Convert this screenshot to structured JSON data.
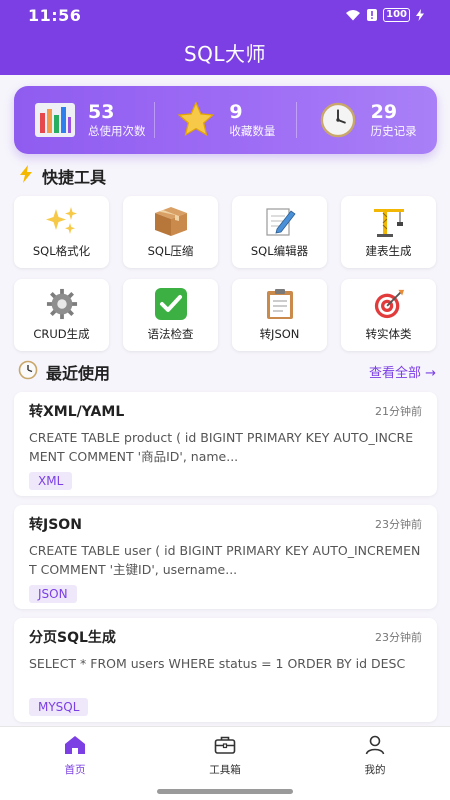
{
  "status": {
    "time": "11:56",
    "battery": "100"
  },
  "app": {
    "title": "SQL大师"
  },
  "stats": [
    {
      "value": "53",
      "label": "总使用次数",
      "icon": "bar-chart-icon"
    },
    {
      "value": "9",
      "label": "收藏数量",
      "icon": "star-icon"
    },
    {
      "value": "29",
      "label": "历史记录",
      "icon": "clock-icon"
    }
  ],
  "quick_tools": {
    "heading": "快捷工具",
    "items": [
      {
        "label": "SQL格式化",
        "icon": "sparkles-icon"
      },
      {
        "label": "SQL压缩",
        "icon": "package-icon"
      },
      {
        "label": "SQL编辑器",
        "icon": "notepad-pencil-icon"
      },
      {
        "label": "建表生成",
        "icon": "crane-icon"
      },
      {
        "label": "CRUD生成",
        "icon": "gear-icon"
      },
      {
        "label": "语法检查",
        "icon": "checkmark-icon"
      },
      {
        "label": "转JSON",
        "icon": "clipboard-icon"
      },
      {
        "label": "转实体类",
        "icon": "target-icon"
      }
    ]
  },
  "recent": {
    "heading": "最近使用",
    "see_all": "查看全部 →",
    "items": [
      {
        "title": "转XML/YAML",
        "time": "21分钟前",
        "content": "CREATE TABLE product ( id BIGINT PRIMARY KEY AUTO_INCREMENT COMMENT '商品ID', name...",
        "tag": "XML"
      },
      {
        "title": "转JSON",
        "time": "23分钟前",
        "content": "CREATE TABLE user ( id BIGINT PRIMARY KEY AUTO_INCREMENT COMMENT '主键ID', username...",
        "tag": "JSON"
      },
      {
        "title": "分页SQL生成",
        "time": "23分钟前",
        "content": "SELECT * FROM users WHERE status = 1 ORDER BY id DESC",
        "tag": "MYSQL"
      }
    ]
  },
  "nav": [
    {
      "label": "首页",
      "icon": "home-icon",
      "active": true
    },
    {
      "label": "工具箱",
      "icon": "toolbox-icon",
      "active": false
    },
    {
      "label": "我的",
      "icon": "user-icon",
      "active": false
    }
  ],
  "colors": {
    "primary": "#7b3fe4",
    "background": "#f6f5fb",
    "tag_bg": "#efe8fb"
  }
}
